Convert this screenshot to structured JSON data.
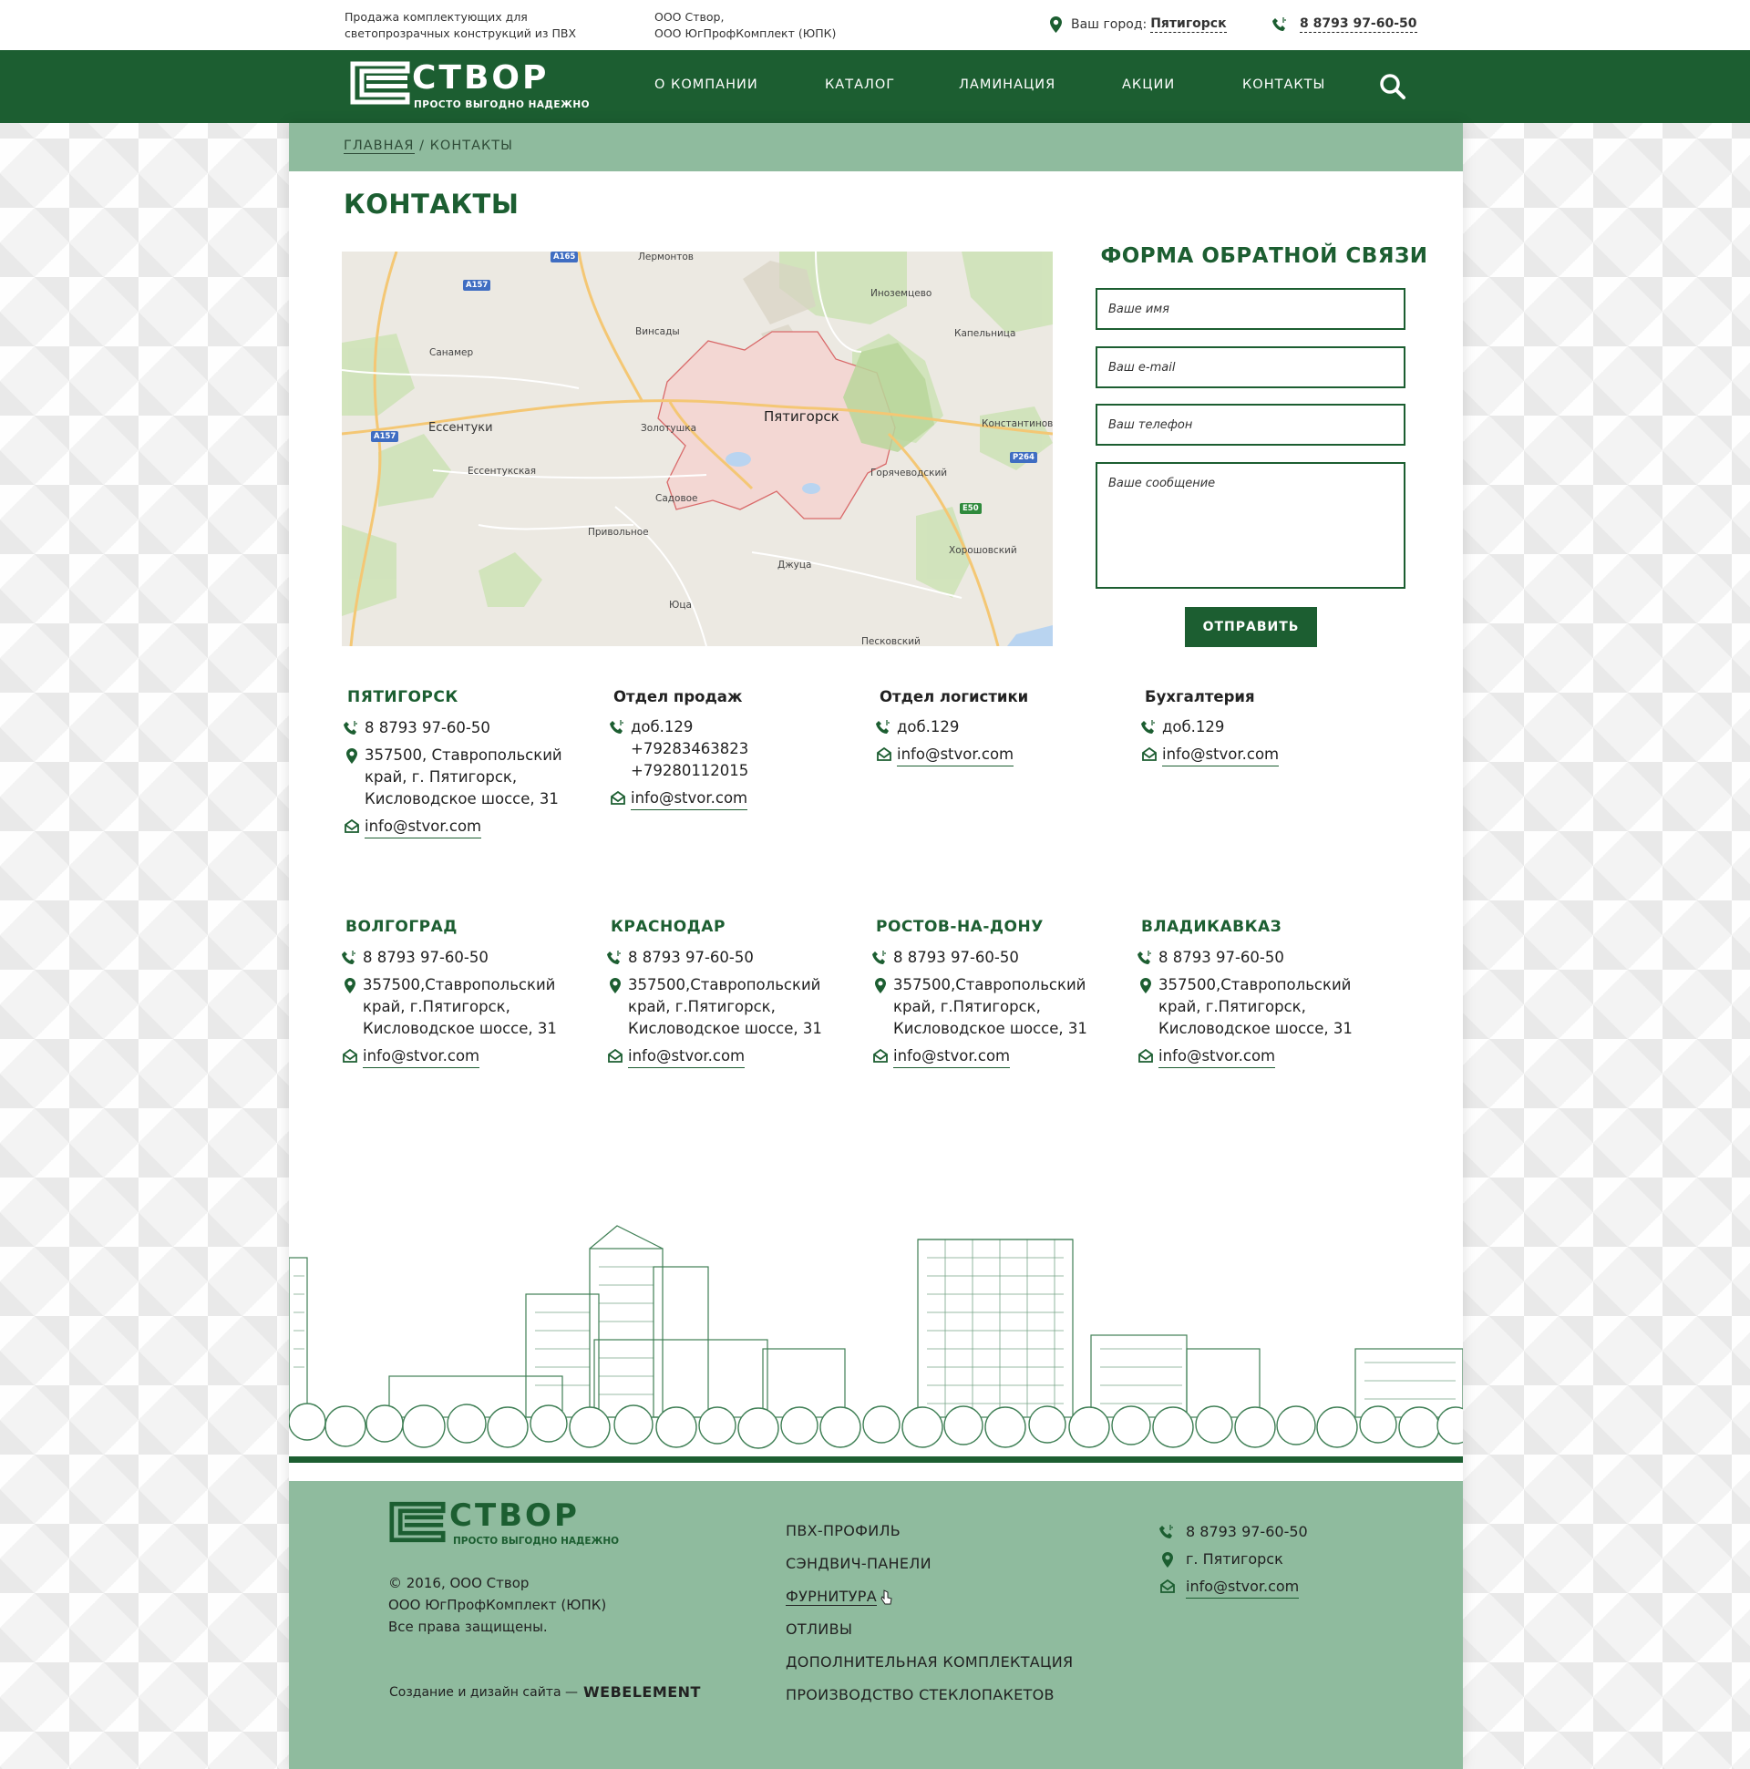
{
  "topbar": {
    "tagline": "Продажа комплектующих для светопрозрачных конструкций из ПВХ",
    "org_line1": "ООО Створ,",
    "org_line2": "ООО ЮгПрофКомплект (ЮПК)",
    "city_label": "Ваш город:",
    "city_value": "Пятигорск",
    "phone": "8 8793  97-60-50"
  },
  "logo": {
    "name": "СТВОР",
    "slogan": "ПРОСТО ВЫГОДНО НАДЕЖНО"
  },
  "nav": {
    "items": [
      "О КОМПАНИИ",
      "КАТАЛОГ",
      "ЛАМИНАЦИЯ",
      "АКЦИИ",
      "КОНТАКТЫ"
    ]
  },
  "breadcrumb": {
    "home": "ГЛАВНАЯ",
    "separator": " / ",
    "current": "КОНТАКТЫ"
  },
  "page_title": "КОНТАКТЫ",
  "map": {
    "labels": [
      "Лермонтов",
      "Иноземцево",
      "Винсады",
      "Капельница",
      "Санамер",
      "Пятигорск",
      "Ессентуки",
      "Золотушка",
      "Константиново",
      "Ессентукская",
      "Горячеводский",
      "Садовое",
      "Привольное",
      "Хорошовский",
      "Джуца",
      "Юца",
      "Песковский"
    ],
    "roads": [
      "A165",
      "A157",
      "A157",
      "P264",
      "E50"
    ]
  },
  "form": {
    "title": "ФОРМА ОБРАТНОЙ СВЯЗИ",
    "name_placeholder": "Ваше имя",
    "email_placeholder": "Ваш e-mail",
    "phone_placeholder": "Ваш телефон",
    "message_placeholder": "Ваше сообщение",
    "submit_label": "ОТПРАВИТЬ"
  },
  "main_contacts": {
    "pyatigorsk": {
      "title": "ПЯТИГОРСК",
      "phone": "8 8793  97-60-50",
      "address": "357500, Ставропольский край, г. Пятигорск, Кисловодское шоссе, 31",
      "email": "info@stvor.com"
    },
    "sales": {
      "title": "Отдел продаж",
      "phones": [
        "доб.129",
        "+79283463823",
        "+79280112015"
      ],
      "email": "info@stvor.com"
    },
    "logistics": {
      "title": "Отдел логистики",
      "phone": "доб.129",
      "email": "info@stvor.com"
    },
    "accounting": {
      "title": "Бухгалтерия",
      "phone": "доб.129",
      "email": "info@stvor.com"
    }
  },
  "branches": [
    {
      "title": "ВОЛГОГРАД",
      "phone": "8 8793  97-60-50",
      "address": "357500,Ставропольский край,  г.Пятигорск, Кисловодское шоссе, 31",
      "email": "info@stvor.com"
    },
    {
      "title": "КРАСНОДАР",
      "phone": "8 8793  97-60-50",
      "address": "357500,Ставропольский край,  г.Пятигорск, Кисловодское шоссе, 31",
      "email": "info@stvor.com"
    },
    {
      "title": "РОСТОВ-НА-ДОНУ",
      "phone": "8 8793  97-60-50",
      "address": "357500,Ставропольский край,  г.Пятигорск, Кисловодское шоссе, 31",
      "email": "info@stvor.com"
    },
    {
      "title": "ВЛАДИКАВКАЗ",
      "phone": "8 8793  97-60-50",
      "address": "357500,Ставропольский край,  г.Пятигорск, Кисловодское шоссе, 31",
      "email": "info@stvor.com"
    }
  ],
  "footer": {
    "copyright_line1": "© 2016,  ООО Створ",
    "copyright_line2": "ООО ЮгПрофКомплект (ЮПК)",
    "copyright_line3": "Все права защищены.",
    "dev_label": "Создание и дизайн сайта —",
    "dev_brand": "WEBELEMENT",
    "menu": [
      "ПВХ-ПРОФИЛЬ",
      "СЭНДВИЧ-ПАНЕЛИ",
      "ФУРНИТУРА",
      "ОТЛИВЫ",
      "ДОПОЛНИТЕЛЬНАЯ КОМПЛЕКТАЦИЯ",
      "ПРОИЗВОДСТВО СТЕКЛОПАКЕТОВ"
    ],
    "phone": "8 8793  97-60-50",
    "city": "г. Пятигорск",
    "email": "info@stvor.com"
  },
  "colors": {
    "brand_green": "#1c5e31",
    "light_green": "#8fbb9e"
  },
  "icons": [
    "map-pin-icon",
    "phone-icon",
    "email-icon",
    "search-icon",
    "cursor-icon"
  ]
}
